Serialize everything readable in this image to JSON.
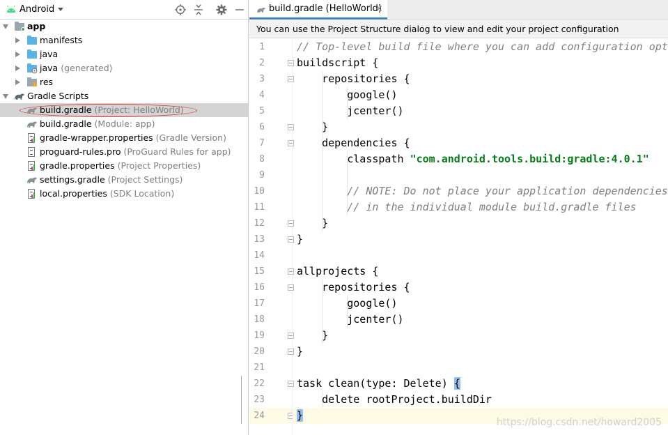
{
  "panel": {
    "title": "Android",
    "icons": [
      "locate-icon",
      "collapse-icon",
      "gear-icon",
      "minimize-icon"
    ]
  },
  "tree": [
    {
      "label": "app",
      "hint": "",
      "icon": "module-folder-icon",
      "expanded": true
    },
    {
      "label": "manifests",
      "hint": "",
      "icon": "folder-icon",
      "expanded": false
    },
    {
      "label": "java",
      "hint": "",
      "icon": "folder-icon",
      "expanded": false
    },
    {
      "label": "java",
      "hint": "(generated)",
      "icon": "generated-folder-icon",
      "expanded": false
    },
    {
      "label": "res",
      "hint": "",
      "icon": "resource-folder-icon",
      "expanded": false
    },
    {
      "label": "Gradle Scripts",
      "hint": "",
      "icon": "gradle-icon",
      "expanded": true
    },
    {
      "label": "build.gradle",
      "hint": "(Project: HelloWorld)",
      "icon": "gradle-icon",
      "selected": true
    },
    {
      "label": "build.gradle",
      "hint": "(Module: app)",
      "icon": "gradle-icon"
    },
    {
      "label": "gradle-wrapper.properties",
      "hint": "(Gradle Version)",
      "icon": "properties-icon"
    },
    {
      "label": "proguard-rules.pro",
      "hint": "(ProGuard Rules for app)",
      "icon": "text-file-icon"
    },
    {
      "label": "gradle.properties",
      "hint": "(Project Properties)",
      "icon": "properties-icon"
    },
    {
      "label": "settings.gradle",
      "hint": "(Project Settings)",
      "icon": "gradle-icon"
    },
    {
      "label": "local.properties",
      "hint": "(SDK Location)",
      "icon": "properties-icon"
    }
  ],
  "editor": {
    "tab_label": "build.gradle (HelloWorld)",
    "tab_close": "×",
    "notice": "You can use the Project Structure dialog to view and edit your project configuration",
    "lines": [
      "// Top-level build file where you can add configuration opt",
      "buildscript {",
      "    repositories {",
      "        google()",
      "        jcenter()",
      "    }",
      "    dependencies {",
      "        classpath \"com.android.tools.build:gradle:4.0.1\"",
      "",
      "        // NOTE: Do not place your application dependencies",
      "        // in the individual module build.gradle files",
      "    }",
      "}",
      "",
      "allprojects {",
      "    repositories {",
      "        google()",
      "        jcenter()",
      "    }",
      "}",
      "",
      "task clean(type: Delete) {",
      "    delete rootProject.buildDir",
      "}"
    ],
    "current_line": 24
  },
  "watermark": "https://blog.csdn.net/howard2005"
}
